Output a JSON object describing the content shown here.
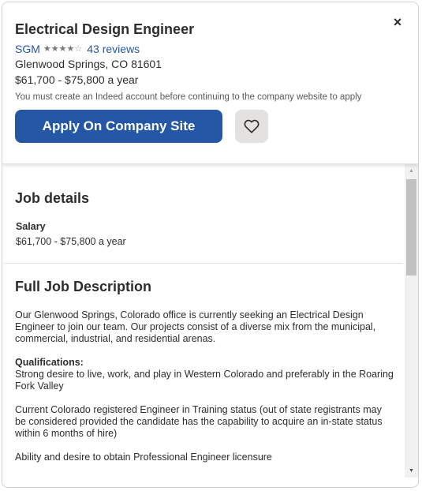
{
  "header": {
    "title": "Electrical Design Engineer",
    "close_icon": "×",
    "company": "SGM",
    "rating_stars": 3.5,
    "reviews": "43 reviews",
    "location": "Glenwood Springs, CO 81601",
    "salary": "$61,700 - $75,800 a year",
    "notice": "You must create an Indeed account before continuing to the company website to apply",
    "apply_label": "Apply On Company Site",
    "accent_color": "#2557a7"
  },
  "details": {
    "title": "Job details",
    "salary_label": "Salary",
    "salary_value": "$61,700 - $75,800 a year"
  },
  "description": {
    "title": "Full Job Description",
    "intro": "Our Glenwood Springs, Colorado office is currently seeking an Electrical Design Engineer to join our team. Our projects consist of a diverse mix from the municipal, commercial, industrial, and residential arenas.",
    "qualifications_heading": "Qualifications:",
    "qualifications_1": "Strong desire to live, work, and play in Western Colorado and preferably in the Roaring Fork Valley",
    "qualifications_2": "Current Colorado registered Engineer in Training status (out of state registrants may be considered provided the candidate has the capability to acquire an in-state status within 6 months of hire)",
    "qualifications_3": "Ability and desire to obtain Professional Engineer licensure"
  }
}
